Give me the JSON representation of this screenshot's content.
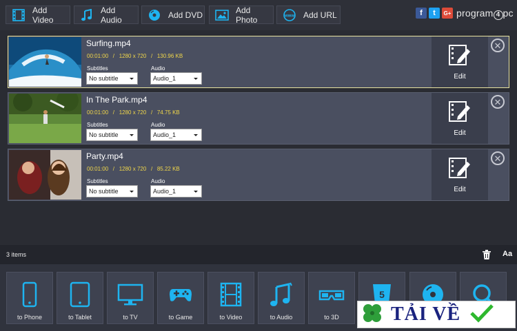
{
  "toolbar": {
    "buttons": [
      {
        "label": "Add Video",
        "icon": "film-icon"
      },
      {
        "label": "Add Audio",
        "icon": "music-note-icon"
      },
      {
        "label": "Add DVD",
        "icon": "dvd-icon"
      },
      {
        "label": "Add Photo",
        "icon": "photo-icon"
      },
      {
        "label": "Add URL",
        "icon": "www-icon"
      }
    ],
    "social": [
      {
        "label": "f",
        "color": "#3b5998"
      },
      {
        "label": "t",
        "color": "#1da1f2"
      },
      {
        "label": "G+",
        "color": "#dd4b39"
      }
    ],
    "brand": {
      "prefix": "program",
      "mark": "4",
      "suffix": "pc"
    }
  },
  "files": [
    {
      "name": "Surfing.mp4",
      "meta": "00:01:00   /   1280 x 720   /   130.96 KB",
      "subtitles_label": "Subtitles",
      "subtitle": "No subtitle",
      "audio_label": "Audio",
      "audio": "Audio_1",
      "edit": "Edit",
      "selected": true
    },
    {
      "name": "In The Park.mp4",
      "meta": "00:01:00   /   1280 x 720   /   74.75 KB",
      "subtitles_label": "Subtitles",
      "subtitle": "No subtitle",
      "audio_label": "Audio",
      "audio": "Audio_1",
      "edit": "Edit",
      "selected": false
    },
    {
      "name": "Party.mp4",
      "meta": "00:01:00   /   1280 x 720   /   85.22 KB",
      "subtitles_label": "Subtitles",
      "subtitle": "No subtitle",
      "audio_label": "Audio",
      "audio": "Audio_1",
      "edit": "Edit",
      "selected": false
    }
  ],
  "status": {
    "count": "3  items",
    "font_label": "Aa"
  },
  "convert": [
    {
      "label": "to Phone",
      "icon": "phone-icon"
    },
    {
      "label": "to Tablet",
      "icon": "tablet-icon"
    },
    {
      "label": "to TV",
      "icon": "tv-icon"
    },
    {
      "label": "to Game",
      "icon": "gamepad-icon"
    },
    {
      "label": "to Video",
      "icon": "film-icon"
    },
    {
      "label": "to Audio",
      "icon": "music-notes-icon"
    },
    {
      "label": "to 3D",
      "icon": "3d-glasses-icon"
    },
    {
      "label": "",
      "icon": "html5-icon"
    },
    {
      "label": "",
      "icon": "disc-icon"
    },
    {
      "label": "",
      "icon": "search-icon"
    }
  ],
  "watermark": {
    "text": "TẢI VỀ"
  },
  "colors": {
    "accent": "#1eb4f0",
    "meta": "#f0d64a",
    "selected_border": "#e8e3a0"
  }
}
